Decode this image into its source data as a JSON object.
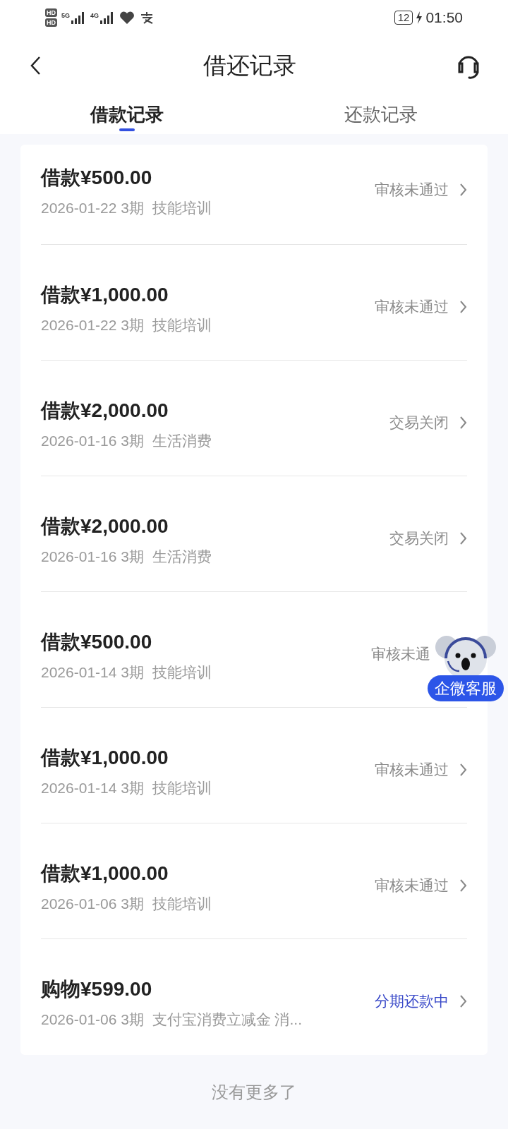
{
  "status_bar": {
    "sim_labels": [
      "HD",
      "HD"
    ],
    "networks": [
      "5G",
      "4G"
    ],
    "battery": "12",
    "time": "01:50"
  },
  "header": {
    "title": "借还记录"
  },
  "tabs": [
    {
      "label": "借款记录",
      "selected": true
    },
    {
      "label": "还款记录",
      "selected": false
    }
  ],
  "records": [
    {
      "title": "借款¥500.00",
      "date": "2026-01-22",
      "term": "3期",
      "purpose": "技能培训",
      "status": "审核未通过",
      "kind": "rejected"
    },
    {
      "title": "借款¥1,000.00",
      "date": "2026-01-22",
      "term": "3期",
      "purpose": "技能培训",
      "status": "审核未通过",
      "kind": "rejected"
    },
    {
      "title": "借款¥2,000.00",
      "date": "2026-01-16",
      "term": "3期",
      "purpose": "生活消费",
      "status": "交易关闭",
      "kind": "closed"
    },
    {
      "title": "借款¥2,000.00",
      "date": "2026-01-16",
      "term": "3期",
      "purpose": "生活消费",
      "status": "交易关闭",
      "kind": "closed"
    },
    {
      "title": "借款¥500.00",
      "date": "2026-01-14",
      "term": "3期",
      "purpose": "技能培训",
      "status": "审核未通",
      "kind": "rejected",
      "arrow": false
    },
    {
      "title": "借款¥1,000.00",
      "date": "2026-01-14",
      "term": "3期",
      "purpose": "技能培训",
      "status": "审核未通过",
      "kind": "rejected"
    },
    {
      "title": "借款¥1,000.00",
      "date": "2026-01-06",
      "term": "3期",
      "purpose": "技能培训",
      "status": "审核未通过",
      "kind": "rejected"
    },
    {
      "title": "购物¥599.00",
      "date": "2026-01-06",
      "term": "3期",
      "purpose": "支付宝消费立减金 消...",
      "status": "分期还款中",
      "kind": "active"
    }
  ],
  "floating_service": {
    "label": "企微客服"
  },
  "footer": "没有更多了"
}
